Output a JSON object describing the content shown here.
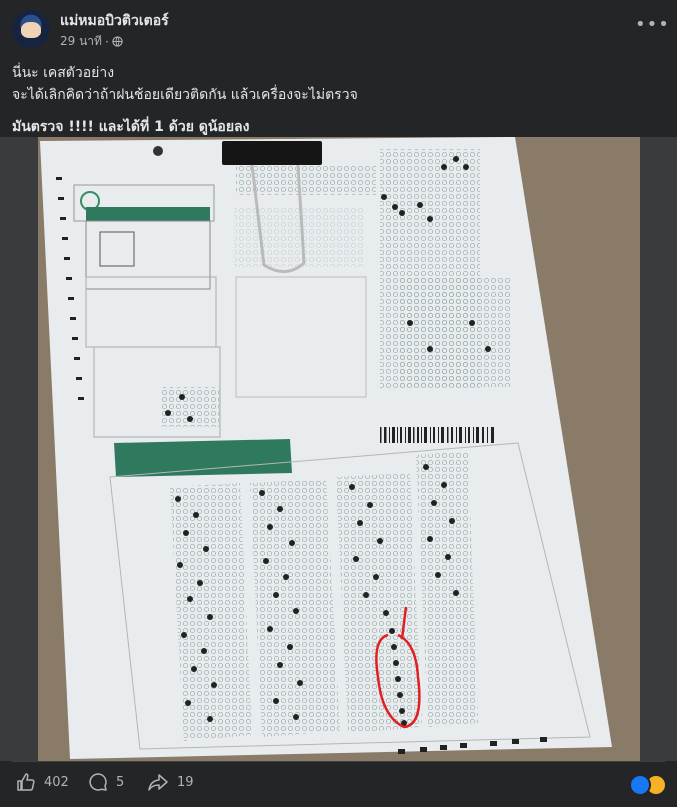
{
  "post": {
    "author": "แม่หมอบิวติวเตอร์",
    "time": "29 นาที",
    "dot": "·",
    "text_line1": "นี่นะ เคสตัวอย่าง",
    "text_line2": "จะได้เลิกคิดว่าถ้าฝนช้อยเดียวติดกัน แล้วเครื่องจะไม่ตรวจ",
    "text_line3_a": "มันตรวจ !!!! และได้ที่ 1 ด้วย ",
    "text_line3_b": "ดูน้อยลง"
  },
  "stats": {
    "likes": "402",
    "comments": "5",
    "shares": "19"
  },
  "colors": {
    "background": "#242526",
    "text": "#e4e6eb",
    "muted": "#b0b3b8",
    "sheet_green": "#2f7a5f",
    "marker_red": "#e02020"
  },
  "icons": [
    "globe-icon",
    "more-options-icon",
    "like-icon",
    "comment-icon",
    "share-icon",
    "like-reaction-icon",
    "haha-reaction-icon"
  ]
}
